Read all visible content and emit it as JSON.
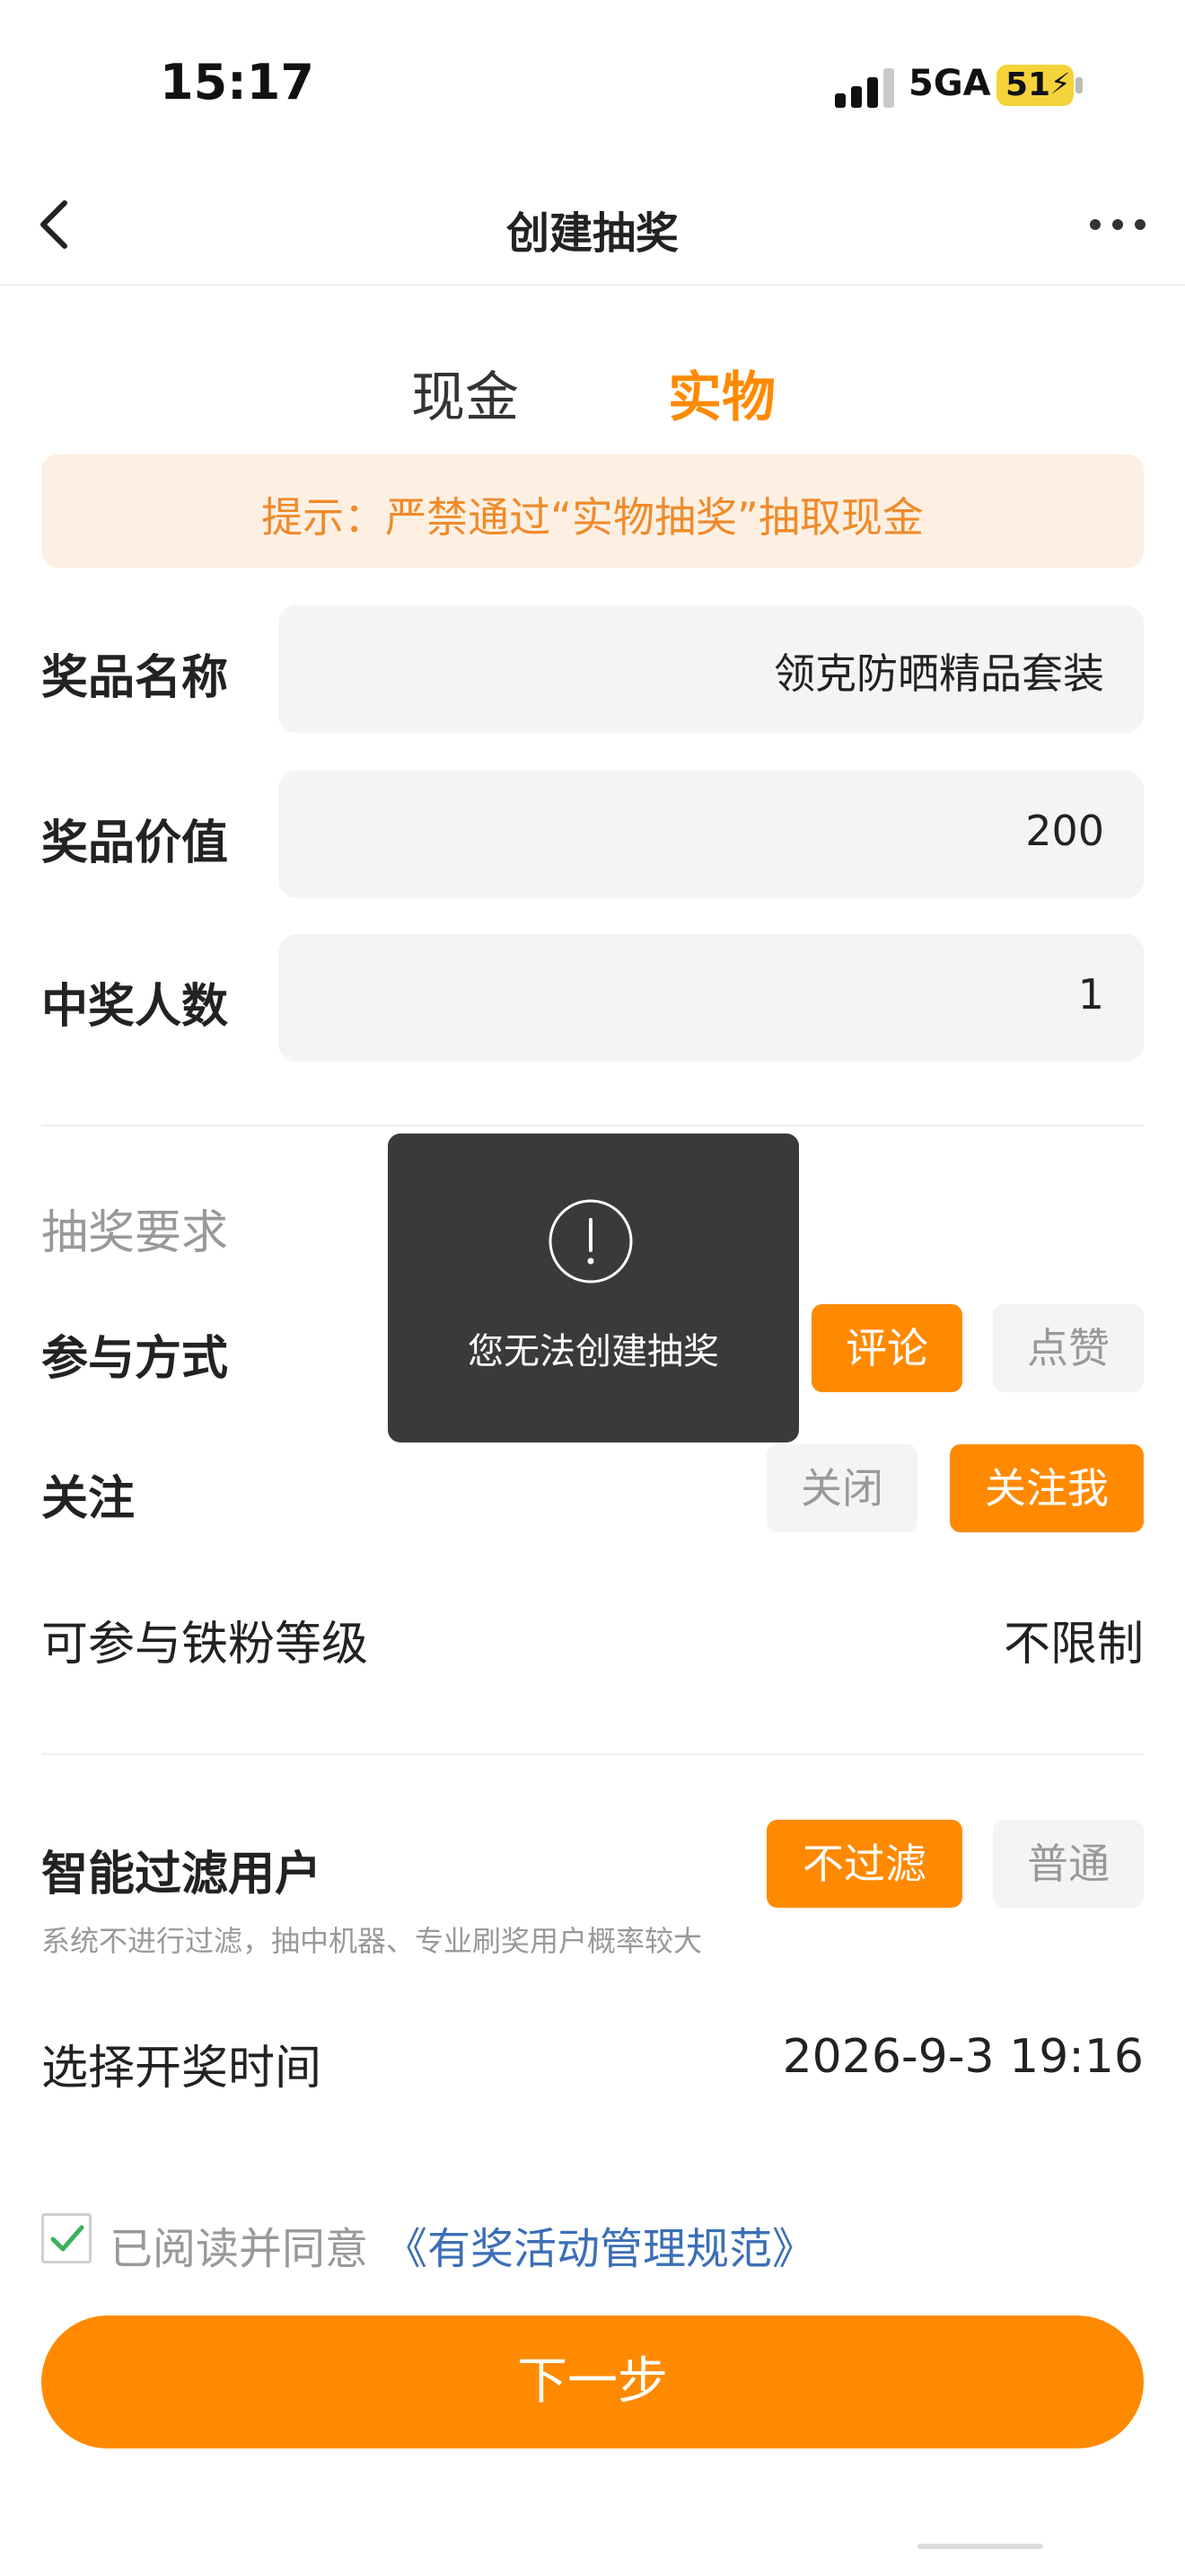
{
  "status_bar": {
    "time": "15:17",
    "network": "5GA",
    "battery": "51"
  },
  "nav": {
    "title": "创建抽奖"
  },
  "tabs": [
    {
      "label": "现金",
      "active": false
    },
    {
      "label": "实物",
      "active": true
    }
  ],
  "notice": {
    "text": "提示：严禁通过“实物抽奖”抽取现金"
  },
  "form": {
    "prize_name": {
      "label": "奖品名称",
      "value": "领克防晒精品套装"
    },
    "prize_value": {
      "label": "奖品价值",
      "value": "200"
    },
    "winners": {
      "label": "中奖人数",
      "value": "1"
    }
  },
  "requirements": {
    "section_title": "抽奖要求",
    "participation": {
      "label": "参与方式",
      "options": [
        "评论",
        "点赞"
      ],
      "selected": "评论"
    },
    "follow": {
      "label": "关注",
      "options": [
        "关闭",
        "关注我"
      ],
      "selected": "关注我"
    },
    "fan_level": {
      "label": "可参与铁粉等级",
      "value": "不限制"
    }
  },
  "filter": {
    "label": "智能过滤用户",
    "options": [
      "不过滤",
      "普通"
    ],
    "selected": "不过滤",
    "hint": "系统不进行过滤，抽中机器、专业刷奖用户概率较大"
  },
  "draw_time": {
    "label": "选择开奖时间",
    "value": "2026-9-3 19:16"
  },
  "agreement": {
    "checked": true,
    "text": "已阅读并同意",
    "link": "《有奖活动管理规范》"
  },
  "next_button": {
    "label": "下一步"
  },
  "toast": {
    "message": "您无法创建抽奖"
  },
  "colors": {
    "accent": "#ff8a00",
    "notice_bg": "#fdf0e3",
    "notice_text": "#f08a2a",
    "link": "#3c6fb6",
    "toast_bg": "#333333"
  }
}
